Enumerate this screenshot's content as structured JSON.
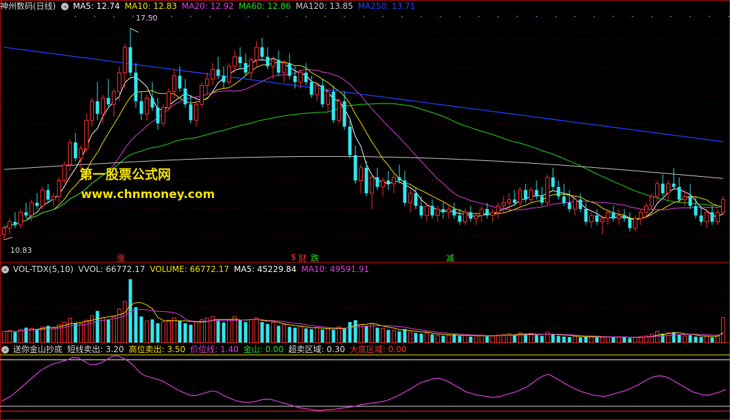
{
  "main_panel": {
    "title": "神州数码(日线)",
    "ma_labels": [
      {
        "text": "MA5: 12.74",
        "color": "#ffffff"
      },
      {
        "text": "MA10: 12.83",
        "color": "#f5e400"
      },
      {
        "text": "MA20: 12.92",
        "color": "#e040e0"
      },
      {
        "text": "MA60: 12.86",
        "color": "#20e020"
      },
      {
        "text": "MA120: 13.85",
        "color": "#cccccc"
      },
      {
        "text": "MA250: 13.71",
        "color": "#2040ff"
      }
    ],
    "high_label": "17.50",
    "low_label": "10.83",
    "signals": [
      {
        "text": "涨",
        "color": "#ff3030"
      },
      {
        "text": "$",
        "color": "#ff3030"
      },
      {
        "text": "财",
        "color": "#ff3030"
      },
      {
        "text": "跌",
        "color": "#20e020"
      },
      {
        "text": "减",
        "color": "#20e020"
      }
    ],
    "watermark_cn": "第一股票公式网",
    "watermark_url": "www.chnmoney.com"
  },
  "volume_panel": {
    "labels": [
      {
        "text": "VOL-TDX(5,10)",
        "color": "#dddddd"
      },
      {
        "text": "VVOL: 66772.17",
        "color": "#dddddd"
      },
      {
        "text": "VOLUME: 66772.17",
        "color": "#f5e400"
      },
      {
        "text": "MA5: 45229.84",
        "color": "#ffffff"
      },
      {
        "text": "MA10: 49591.91",
        "color": "#e040e0"
      }
    ]
  },
  "indicator_panel": {
    "labels": [
      {
        "text": "送你金山抄底",
        "color": "#dddddd"
      },
      {
        "text": "短线卖出: 3.20",
        "color": "#dddddd"
      },
      {
        "text": "高位卖出: 3.50",
        "color": "#f5e400"
      },
      {
        "text": "价位线: 1.40",
        "color": "#e040e0"
      },
      {
        "text": "金山: 0.00",
        "color": "#20e020"
      },
      {
        "text": "超卖区域: 0.30",
        "color": "#dddddd"
      },
      {
        "text": "大底区域: 0.00",
        "color": "#ff3030"
      }
    ]
  },
  "chart_data": [
    {
      "type": "candlestick",
      "ylim": [
        10.4,
        18.0
      ],
      "grid": true,
      "candles": [
        [
          11.0,
          11.3,
          10.83,
          11.2
        ],
        [
          11.2,
          11.5,
          11.0,
          11.4
        ],
        [
          11.4,
          11.7,
          11.2,
          11.3
        ],
        [
          11.3,
          11.8,
          11.2,
          11.7
        ],
        [
          11.7,
          12.0,
          11.5,
          11.6
        ],
        [
          11.6,
          12.1,
          11.4,
          12.0
        ],
        [
          12.0,
          12.3,
          11.8,
          11.9
        ],
        [
          11.9,
          12.5,
          11.8,
          12.4
        ],
        [
          12.4,
          12.6,
          12.0,
          12.1
        ],
        [
          12.1,
          12.3,
          11.9,
          12.2
        ],
        [
          12.2,
          12.8,
          12.0,
          12.7
        ],
        [
          12.7,
          13.3,
          12.6,
          13.2
        ],
        [
          13.2,
          14.0,
          13.0,
          13.9
        ],
        [
          13.9,
          14.2,
          13.3,
          13.4
        ],
        [
          13.4,
          13.8,
          13.0,
          13.7
        ],
        [
          13.7,
          14.8,
          13.6,
          14.6
        ],
        [
          14.6,
          15.3,
          14.4,
          15.2
        ],
        [
          15.2,
          15.8,
          14.6,
          14.8
        ],
        [
          14.8,
          15.4,
          14.5,
          15.3
        ],
        [
          15.3,
          15.9,
          15.0,
          15.1
        ],
        [
          15.1,
          15.6,
          14.7,
          15.5
        ],
        [
          15.5,
          16.3,
          15.2,
          16.1
        ],
        [
          16.1,
          17.0,
          15.6,
          16.9
        ],
        [
          16.9,
          17.5,
          16.0,
          16.1
        ],
        [
          16.1,
          16.4,
          15.0,
          15.2
        ],
        [
          15.2,
          15.5,
          14.6,
          14.8
        ],
        [
          14.8,
          15.4,
          14.6,
          15.3
        ],
        [
          15.3,
          15.8,
          14.9,
          15.0
        ],
        [
          15.0,
          15.3,
          14.3,
          14.5
        ],
        [
          14.5,
          15.1,
          14.4,
          15.0
        ],
        [
          15.0,
          15.6,
          14.9,
          15.5
        ],
        [
          15.5,
          16.2,
          15.3,
          16.0
        ],
        [
          16.0,
          16.3,
          15.5,
          15.6
        ],
        [
          15.6,
          15.9,
          15.0,
          15.1
        ],
        [
          15.1,
          15.4,
          14.5,
          14.6
        ],
        [
          14.6,
          15.2,
          14.4,
          15.1
        ],
        [
          15.1,
          15.8,
          15.0,
          15.7
        ],
        [
          15.7,
          16.1,
          15.4,
          15.9
        ],
        [
          15.9,
          16.4,
          15.7,
          16.2
        ],
        [
          16.2,
          16.6,
          15.9,
          16.0
        ],
        [
          16.0,
          16.3,
          15.6,
          15.8
        ],
        [
          15.8,
          16.4,
          15.7,
          16.3
        ],
        [
          16.3,
          16.8,
          16.1,
          16.6
        ],
        [
          16.6,
          16.9,
          16.2,
          16.4
        ],
        [
          16.4,
          16.7,
          16.0,
          16.1
        ],
        [
          16.1,
          16.6,
          15.9,
          16.5
        ],
        [
          16.5,
          17.1,
          16.3,
          16.9
        ],
        [
          16.9,
          17.2,
          16.5,
          16.6
        ],
        [
          16.6,
          16.9,
          16.2,
          16.3
        ],
        [
          16.3,
          16.6,
          15.9,
          16.5
        ],
        [
          16.5,
          16.8,
          16.0,
          16.1
        ],
        [
          16.1,
          16.5,
          15.8,
          16.4
        ],
        [
          16.4,
          16.7,
          15.9,
          16.0
        ],
        [
          16.0,
          16.3,
          15.6,
          15.8
        ],
        [
          15.8,
          16.2,
          15.6,
          16.1
        ],
        [
          16.1,
          16.4,
          15.7,
          15.8
        ],
        [
          15.8,
          16.0,
          15.3,
          15.4
        ],
        [
          15.4,
          15.8,
          15.2,
          15.7
        ],
        [
          15.7,
          15.9,
          15.0,
          15.1
        ],
        [
          15.1,
          15.6,
          14.9,
          15.5
        ],
        [
          15.5,
          15.7,
          14.5,
          14.6
        ],
        [
          14.6,
          15.3,
          14.5,
          15.2
        ],
        [
          15.2,
          15.5,
          14.3,
          14.4
        ],
        [
          14.4,
          14.6,
          13.4,
          13.5
        ],
        [
          13.5,
          13.8,
          12.6,
          12.7
        ],
        [
          12.7,
          13.2,
          12.3,
          13.1
        ],
        [
          13.1,
          13.3,
          12.2,
          12.3
        ],
        [
          12.3,
          12.9,
          11.8,
          12.8
        ],
        [
          12.8,
          13.1,
          12.4,
          12.5
        ],
        [
          12.5,
          12.8,
          12.2,
          12.7
        ],
        [
          12.7,
          13.0,
          12.4,
          12.6
        ],
        [
          12.6,
          12.9,
          12.3,
          12.8
        ],
        [
          12.8,
          13.2,
          12.6,
          12.7
        ],
        [
          12.7,
          13.0,
          11.9,
          12.0
        ],
        [
          12.0,
          12.4,
          11.7,
          12.3
        ],
        [
          12.3,
          12.5,
          11.8,
          11.9
        ],
        [
          11.9,
          12.2,
          11.5,
          11.6
        ],
        [
          11.6,
          12.0,
          11.4,
          11.9
        ],
        [
          11.9,
          12.1,
          11.5,
          11.6
        ],
        [
          11.6,
          11.9,
          11.4,
          11.8
        ],
        [
          11.8,
          12.0,
          11.5,
          11.7
        ],
        [
          11.7,
          11.9,
          11.5,
          11.8
        ],
        [
          11.8,
          12.0,
          11.5,
          11.6
        ],
        [
          11.6,
          11.8,
          11.3,
          11.4
        ],
        [
          11.4,
          11.8,
          11.3,
          11.7
        ],
        [
          11.7,
          11.9,
          11.4,
          11.5
        ],
        [
          11.5,
          11.7,
          11.3,
          11.6
        ],
        [
          11.6,
          11.9,
          11.4,
          11.8
        ],
        [
          11.8,
          12.0,
          11.5,
          11.6
        ],
        [
          11.6,
          11.8,
          11.4,
          11.7
        ],
        [
          11.7,
          12.0,
          11.5,
          11.9
        ],
        [
          11.9,
          12.2,
          11.7,
          12.0
        ],
        [
          12.0,
          12.3,
          11.8,
          12.1
        ],
        [
          12.1,
          12.4,
          11.9,
          12.0
        ],
        [
          12.0,
          12.5,
          11.9,
          12.4
        ],
        [
          12.4,
          12.6,
          12.0,
          12.1
        ],
        [
          12.1,
          12.5,
          12.0,
          12.4
        ],
        [
          12.4,
          12.7,
          12.1,
          12.2
        ],
        [
          12.2,
          12.5,
          11.9,
          12.0
        ],
        [
          12.0,
          12.9,
          11.9,
          12.8
        ],
        [
          12.8,
          13.1,
          12.4,
          12.5
        ],
        [
          12.5,
          12.7,
          12.1,
          12.2
        ],
        [
          12.2,
          12.6,
          11.9,
          12.0
        ],
        [
          12.0,
          12.4,
          11.7,
          11.8
        ],
        [
          11.8,
          12.2,
          11.6,
          12.1
        ],
        [
          12.1,
          12.3,
          11.7,
          11.8
        ],
        [
          11.8,
          12.0,
          11.3,
          11.4
        ],
        [
          11.4,
          11.7,
          11.2,
          11.6
        ],
        [
          11.6,
          11.8,
          11.3,
          11.4
        ],
        [
          11.4,
          11.6,
          11.0,
          11.5
        ],
        [
          11.5,
          11.8,
          11.3,
          11.7
        ],
        [
          11.7,
          11.9,
          11.4,
          11.5
        ],
        [
          11.5,
          11.8,
          11.3,
          11.6
        ],
        [
          11.6,
          11.8,
          11.4,
          11.5
        ],
        [
          11.5,
          11.7,
          11.1,
          11.2
        ],
        [
          11.2,
          11.6,
          11.1,
          11.5
        ],
        [
          11.5,
          11.8,
          11.3,
          11.7
        ],
        [
          11.7,
          12.0,
          11.5,
          11.9
        ],
        [
          11.9,
          12.3,
          11.8,
          12.2
        ],
        [
          12.2,
          12.7,
          12.0,
          12.6
        ],
        [
          12.6,
          12.9,
          12.2,
          12.3
        ],
        [
          12.3,
          12.7,
          12.1,
          12.6
        ],
        [
          12.6,
          13.1,
          12.4,
          12.5
        ],
        [
          12.5,
          12.8,
          12.0,
          12.1
        ],
        [
          12.1,
          12.4,
          11.9,
          12.2
        ],
        [
          12.2,
          12.6,
          11.8,
          11.9
        ],
        [
          11.9,
          12.2,
          11.5,
          11.6
        ],
        [
          11.6,
          11.9,
          11.3,
          11.4
        ],
        [
          11.4,
          11.8,
          11.2,
          11.7
        ],
        [
          11.7,
          11.9,
          11.3,
          11.4
        ],
        [
          11.4,
          11.8,
          11.3,
          11.7
        ],
        [
          11.7,
          12.2,
          11.6,
          12.1
        ]
      ]
    },
    {
      "type": "bar",
      "ylim": [
        0,
        180000
      ],
      "values": [
        30000,
        32000,
        28000,
        35000,
        40000,
        38000,
        36000,
        42000,
        45000,
        40000,
        48000,
        55000,
        65000,
        52000,
        50000,
        60000,
        72000,
        85000,
        66000,
        62000,
        70000,
        90000,
        110000,
        170000,
        95000,
        70000,
        58000,
        62000,
        52000,
        56000,
        60000,
        66000,
        58000,
        52000,
        48000,
        55000,
        62000,
        66000,
        70000,
        58000,
        54000,
        62000,
        70000,
        60000,
        55000,
        62000,
        66000,
        55000,
        50000,
        54000,
        45000,
        48000,
        42000,
        40000,
        44000,
        38000,
        36000,
        40000,
        35000,
        38000,
        34000,
        42000,
        38000,
        55000,
        60000,
        48000,
        45000,
        50000,
        40000,
        38000,
        34000,
        32000,
        30000,
        36000,
        28000,
        26000,
        24000,
        26000,
        22000,
        20000,
        18000,
        20000,
        22000,
        18000,
        20000,
        16000,
        18000,
        20000,
        17000,
        18000,
        20000,
        22000,
        24000,
        20000,
        26000,
        22000,
        24000,
        20000,
        18000,
        28000,
        22000,
        18000,
        16000,
        15000,
        17000,
        14000,
        16000,
        15000,
        14000,
        15000,
        16000,
        14000,
        15000,
        14000,
        12000,
        14000,
        16000,
        18000,
        22000,
        30000,
        24000,
        26000,
        28000,
        22000,
        18000,
        20000,
        16000,
        15000,
        18000,
        14000,
        20000,
        66772
      ]
    },
    {
      "type": "line",
      "ylim": [
        0,
        3.5
      ],
      "reference_lines": [
        3.2,
        3.5,
        0.3,
        0.0
      ],
      "values": [
        0.6,
        0.8,
        1.0,
        1.3,
        1.6,
        1.9,
        2.2,
        2.5,
        2.7,
        2.9,
        3.0,
        3.1,
        3.2,
        3.35,
        3.3,
        3.1,
        2.9,
        2.9,
        3.0,
        3.2,
        3.4,
        3.45,
        3.3,
        3.1,
        2.8,
        2.4,
        2.2,
        2.1,
        2.0,
        1.9,
        1.7,
        1.5,
        1.3,
        1.15,
        1.0,
        0.95,
        1.05,
        1.15,
        1.25,
        1.2,
        1.0,
        0.85,
        0.7,
        0.6,
        0.55,
        0.55,
        0.6,
        0.7,
        0.75,
        0.7,
        0.6,
        0.5,
        0.4,
        0.3,
        0.2,
        0.15,
        0.1,
        0.05,
        0.05,
        0.1,
        0.1,
        0.15,
        0.2,
        0.25,
        0.3,
        0.4,
        0.45,
        0.5,
        0.55,
        0.6,
        0.7,
        0.85,
        1.0,
        1.2,
        1.4,
        1.6,
        1.8,
        1.9,
        2.0,
        2.05,
        1.95,
        1.8,
        1.6,
        1.4,
        1.2,
        1.1,
        1.0,
        0.95,
        0.9,
        0.85,
        0.9,
        1.0,
        1.1,
        1.2,
        1.35,
        1.5,
        1.75,
        2.0,
        2.2,
        2.3,
        2.1,
        1.9,
        1.7,
        1.5,
        1.35,
        1.2,
        1.1,
        1.0,
        0.95,
        0.9,
        1.0,
        1.1,
        1.2,
        1.3,
        1.45,
        1.6,
        1.8,
        2.0,
        2.15,
        2.2,
        2.15,
        2.0,
        1.8,
        1.6,
        1.4,
        1.2,
        1.1,
        1.0,
        1.0,
        1.1,
        1.2,
        1.35
      ]
    }
  ]
}
